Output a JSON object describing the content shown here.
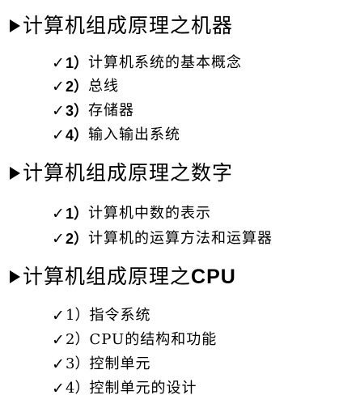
{
  "sections": [
    {
      "title": "计算机组成原理之机器",
      "items": [
        {
          "num": "1）",
          "text": "计算机系统的基本概念"
        },
        {
          "num": "2）",
          "text": "总线"
        },
        {
          "num": "3）",
          "text": "存储器"
        },
        {
          "num": "4）",
          "text": "输入输出系统"
        }
      ]
    },
    {
      "title": "计算机组成原理之数字",
      "items": [
        {
          "num": "1）",
          "text": "计算机中数的表示"
        },
        {
          "num": "2）",
          "text": "计算机的运算方法和运算器"
        }
      ]
    },
    {
      "title_prefix": "计算机组成原理之",
      "title_suffix": "CPU",
      "items": [
        {
          "num": "1）",
          "text": "指令系统"
        },
        {
          "num": "2）",
          "text": "CPU的结构和功能"
        },
        {
          "num": "3）",
          "text": "控制单元"
        },
        {
          "num": "4）",
          "text": "控制单元的设计"
        }
      ]
    }
  ],
  "icons": {
    "heading": "arrow-right-icon",
    "item": "check-icon"
  }
}
